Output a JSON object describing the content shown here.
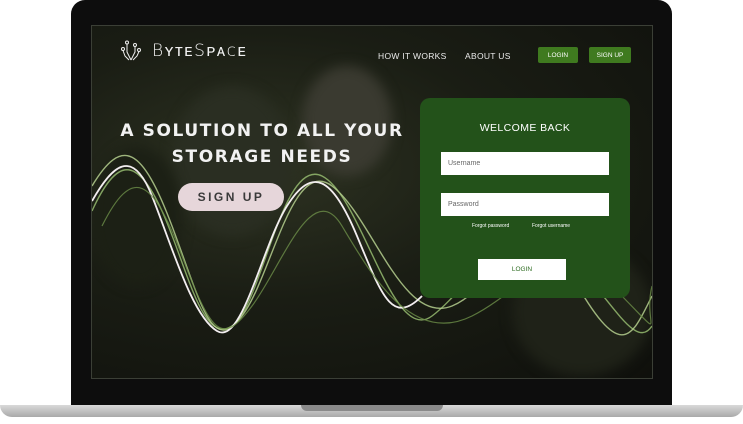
{
  "brand": {
    "name": "BʏᴛᴇSᴘᴀᴄᴇ",
    "icon": "circuit-plant-icon"
  },
  "nav": {
    "how_it_works": "HOW IT WORKS",
    "about_us": "ABOUT US",
    "login": "LOGIN",
    "signup": "SIGN UP"
  },
  "hero": {
    "headline_line1": "A SOLUTION TO ALL YOUR",
    "headline_line2": "STORAGE NEEDS",
    "signup": "SIGN UP"
  },
  "login_panel": {
    "title": "WELCOME BACK",
    "username_placeholder": "Username",
    "password_placeholder": "Password",
    "forgot_password": "Forgot password",
    "forgot_username": "Forgot username",
    "login_button": "LOGIN"
  },
  "colors": {
    "accent_green": "#3f7a1f",
    "panel_green": "#23521a",
    "hero_button": "#e6d6da"
  }
}
